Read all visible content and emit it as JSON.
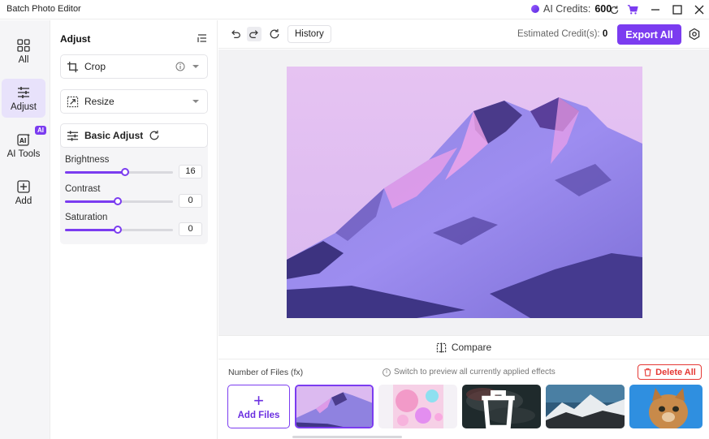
{
  "titlebar": {
    "app_title": "Batch Photo Editor",
    "credits_label": "AI Credits:",
    "credits_value": "600",
    "icons": [
      "refresh-icon",
      "cart-icon",
      "minimize-icon",
      "maximize-icon",
      "close-icon"
    ]
  },
  "leftnav": {
    "items": [
      {
        "label": "All",
        "icon": "grid-icon",
        "active": false
      },
      {
        "label": "Adjust",
        "icon": "sliders-icon",
        "active": true
      },
      {
        "label": "AI Tools",
        "icon": "ai-icon",
        "active": false
      },
      {
        "label": "Add",
        "icon": "plus-square-icon",
        "active": false
      }
    ],
    "ai_badge": "AI"
  },
  "panel": {
    "title": "Adjust",
    "crop_label": "Crop",
    "resize_label": "Resize",
    "basic_adjust_label": "Basic Adjust",
    "sliders": [
      {
        "label": "Brightness",
        "value": "16",
        "fraction": 0.56
      },
      {
        "label": "Contrast",
        "value": "0",
        "fraction": 0.49
      },
      {
        "label": "Saturation",
        "value": "0",
        "fraction": 0.49
      }
    ]
  },
  "toolbar": {
    "history_label": "History",
    "estimated_label": "Estimated Credit(s):",
    "estimated_value": "0",
    "export_label": "Export All"
  },
  "compare_label": "Compare",
  "files": {
    "count_label": "Number of Files (fx)",
    "hint": "Switch to preview all currently applied effects",
    "delete_all_label": "Delete All",
    "add_files_label": "Add Files"
  },
  "colors": {
    "accent": "#7b3cf0",
    "danger": "#e53935"
  }
}
